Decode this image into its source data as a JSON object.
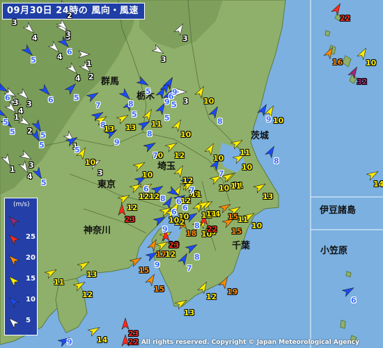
{
  "title": "09月30日 24時の 風向・風速",
  "footer": "All rights reserved. Copyright © Japan Meteorological Agency",
  "region_labels": {
    "gunma": "群馬",
    "tochigi": "栃木",
    "ibaraki": "茨城",
    "saitama": "埼玉",
    "tokyo": "東京",
    "kanagawa": "神奈川",
    "chiba": "千葉",
    "izu": "伊豆諸島",
    "ogasawara": "小笠原"
  },
  "legend": {
    "unit": "(m/s)",
    "levels": [
      {
        "label": "",
        "color": "#a0287a",
        "icon": "arrow-icon"
      },
      {
        "label": "25",
        "color": "#ff2a1a",
        "icon": "arrow-icon"
      },
      {
        "label": "20",
        "color": "#ff8c00",
        "icon": "arrow-icon"
      },
      {
        "label": "15",
        "color": "#ffee00",
        "icon": "arrow-icon"
      },
      {
        "label": "10",
        "color": "#1a4cff",
        "icon": "arrow-icon"
      },
      {
        "label": "5",
        "color": "#ffffff",
        "icon": "arrow-icon"
      }
    ]
  },
  "colors": {
    "sea": "#7bb0e0",
    "land": "#8fb06a",
    "mountain": "#6d8f4e",
    "calm": "#ffffff",
    "light": "#1a4cff",
    "moderate": "#ffee00",
    "strong": "#ff8c00",
    "very_strong": "#ff2a1a",
    "extreme": "#a0287a"
  },
  "wind_readings": [
    {
      "v": 3
    },
    {
      "v": 4
    },
    {
      "v": 2
    },
    {
      "v": 4
    },
    {
      "v": 6
    },
    {
      "v": 5
    },
    {
      "v": 6
    },
    {
      "v": 3
    },
    {
      "v": 3
    },
    {
      "v": 1
    },
    {
      "v": 3
    },
    {
      "v": 4
    },
    {
      "v": 3
    },
    {
      "v": 5
    },
    {
      "v": 8
    },
    {
      "v": 6
    },
    {
      "v": 5
    },
    {
      "v": 4
    },
    {
      "v": 2
    },
    {
      "v": 5
    },
    {
      "v": 9
    },
    {
      "v": 11
    },
    {
      "v": 10
    },
    {
      "v": 8
    },
    {
      "v": 10
    },
    {
      "v": 10
    },
    {
      "v": 9
    },
    {
      "v": 8
    },
    {
      "v": 3
    },
    {
      "v": 10
    },
    {
      "v": 5
    },
    {
      "v": 10
    },
    {
      "v": 5
    },
    {
      "v": 7
    },
    {
      "v": 3
    },
    {
      "v": 6
    },
    {
      "v": 3
    },
    {
      "v": 1
    },
    {
      "v": 9
    },
    {
      "v": 5
    },
    {
      "v": 12
    },
    {
      "v": 10
    },
    {
      "v": 6
    },
    {
      "v": 7
    },
    {
      "v": 1
    },
    {
      "v": 2
    },
    {
      "v": 3
    },
    {
      "v": 5
    },
    {
      "v": 7
    },
    {
      "v": 12
    },
    {
      "v": 8
    },
    {
      "v": 11
    },
    {
      "v": 10
    },
    {
      "v": 6
    },
    {
      "v": 5
    },
    {
      "v": 5
    },
    {
      "v": 9
    },
    {
      "v": 10
    },
    {
      "v": 11
    },
    {
      "v": 13
    },
    {
      "v": 8
    },
    {
      "v": 7
    },
    {
      "v": 11
    },
    {
      "v": 13
    },
    {
      "v": 12
    },
    {
      "v": 1
    },
    {
      "v": 13
    },
    {
      "v": 5
    },
    {
      "v": 8
    },
    {
      "v": 10
    },
    {
      "v": 4
    },
    {
      "v": 13
    },
    {
      "v": 12
    },
    {
      "v": 10
    },
    {
      "v": 11
    },
    {
      "v": 3
    },
    {
      "v": 12
    },
    {
      "v": 11
    },
    {
      "v": 11
    },
    {
      "v": 14
    },
    {
      "v": 6
    },
    {
      "v": 10
    },
    {
      "v": 5
    },
    {
      "v": 11
    },
    {
      "v": 10
    },
    {
      "v": 15
    },
    {
      "v": 12
    },
    {
      "v": 12
    },
    {
      "v": 15
    },
    {
      "v": 6
    },
    {
      "v": 10
    },
    {
      "v": 7
    },
    {
      "v": 23
    },
    {
      "v": 18
    },
    {
      "v": 22
    },
    {
      "v": 23
    },
    {
      "v": 11
    },
    {
      "v": 8
    },
    {
      "v": 9
    },
    {
      "v": 17
    },
    {
      "v": 12
    },
    {
      "v": 10
    },
    {
      "v": 13
    },
    {
      "v": 15
    },
    {
      "v": 9
    },
    {
      "v": 8
    },
    {
      "v": 10
    },
    {
      "v": 11
    },
    {
      "v": 12
    },
    {
      "v": 15
    },
    {
      "v": 7
    },
    {
      "v": 19
    },
    {
      "v": 12
    },
    {
      "v": 13
    },
    {
      "v": 14
    },
    {
      "v": 9
    },
    {
      "v": 23
    },
    {
      "v": 22
    },
    {
      "v": 16
    },
    {
      "v": 10
    },
    {
      "v": 32
    },
    {
      "v": 22
    },
    {
      "v": 14
    },
    {
      "v": 6
    }
  ]
}
